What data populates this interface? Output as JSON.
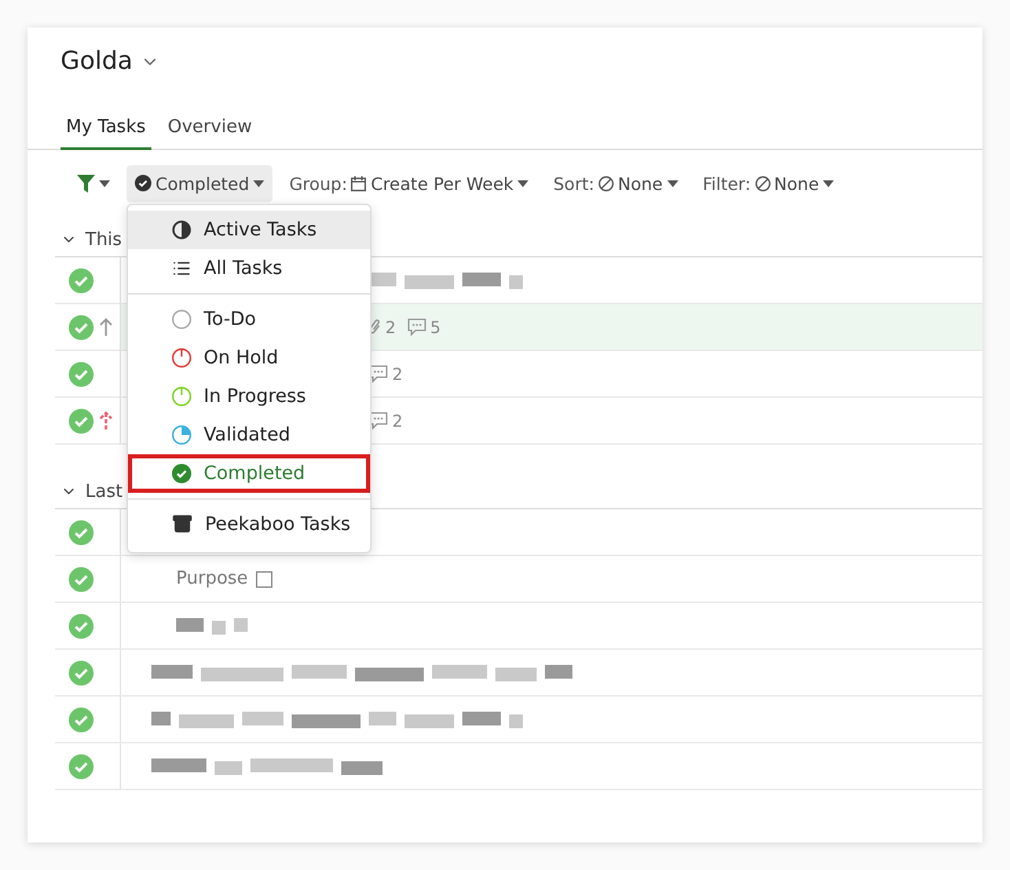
{
  "workspace": {
    "title": "Golda"
  },
  "tabs": [
    {
      "label": "My Tasks",
      "selected": true
    },
    {
      "label": "Overview",
      "selected": false
    }
  ],
  "toolbar": {
    "status_filter": "Completed",
    "group": {
      "label": "Group:",
      "value": "Create Per Week"
    },
    "sort": {
      "label": "Sort:",
      "value": "None"
    },
    "filter": {
      "label": "Filter:",
      "value": "None"
    }
  },
  "groups": [
    {
      "title": "This",
      "rows": [
        {
          "done": true,
          "arrow": false,
          "highlighted": false,
          "redacted": true
        },
        {
          "done": true,
          "arrow": true,
          "urgent": false,
          "highlighted": true,
          "attachments": "2",
          "comments": "5"
        },
        {
          "done": true,
          "arrow": false,
          "highlighted": false,
          "comments": "2"
        },
        {
          "done": true,
          "arrow": true,
          "urgent": true,
          "highlighted": false,
          "comments": "2"
        }
      ]
    },
    {
      "title": "Last",
      "rows": [
        {
          "done": true,
          "arrow": false,
          "highlighted": false,
          "children": [
            {
              "title": "Purpose"
            },
            {
              "redacted": true
            }
          ]
        },
        {
          "done": true,
          "arrow": false,
          "highlighted": false,
          "redacted": true
        },
        {
          "done": true,
          "arrow": false,
          "highlighted": false,
          "redacted": true
        },
        {
          "done": true,
          "arrow": false,
          "highlighted": false,
          "redacted": true
        }
      ]
    }
  ],
  "menu": {
    "sections": [
      {
        "items": [
          {
            "kind": "active",
            "label": "Active Tasks",
            "hovered": true,
            "selected": false
          },
          {
            "kind": "all",
            "label": "All Tasks",
            "hovered": false,
            "selected": false
          }
        ]
      },
      {
        "items": [
          {
            "kind": "todo",
            "label": "To-Do",
            "color": "#aaaaaa",
            "hovered": false,
            "selected": false
          },
          {
            "kind": "onhold",
            "label": "On Hold",
            "color": "#e53935",
            "hovered": false,
            "selected": false
          },
          {
            "kind": "progress",
            "label": "In Progress",
            "color": "#7ed321",
            "hovered": false,
            "selected": false
          },
          {
            "kind": "validated",
            "label": "Validated",
            "color": "#3ab0e0",
            "hovered": false,
            "selected": false
          },
          {
            "kind": "completed",
            "label": "Completed",
            "color": "#2e8b2e",
            "hovered": false,
            "selected": true,
            "annotated": true
          }
        ]
      },
      {
        "items": [
          {
            "kind": "archive",
            "label": "Peekaboo Tasks",
            "hovered": false,
            "selected": false
          }
        ]
      }
    ]
  }
}
